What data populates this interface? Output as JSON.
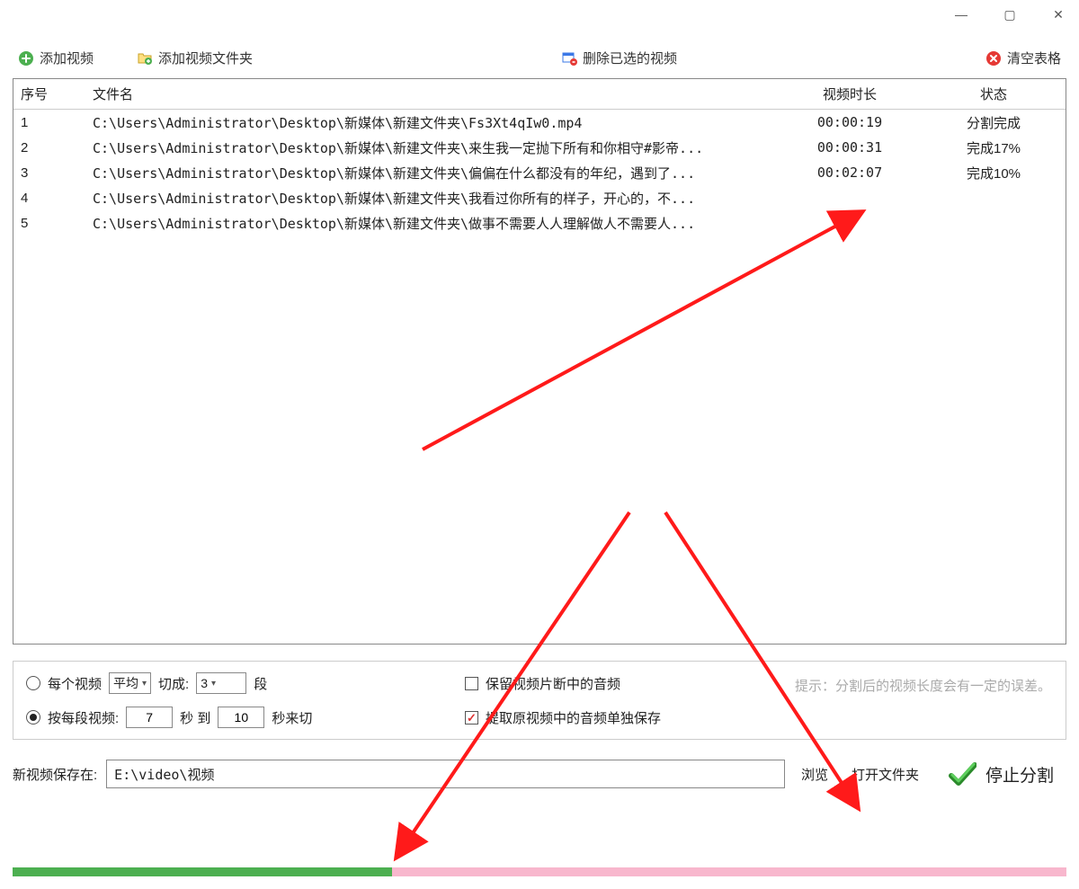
{
  "window": {
    "minimize": "—",
    "maximize": "▢",
    "close": "✕"
  },
  "toolbar": {
    "add_video": "添加视频",
    "add_folder": "添加视频文件夹",
    "delete_selected": "删除已选的视频",
    "clear_table": "清空表格"
  },
  "columns": {
    "idx": "序号",
    "name": "文件名",
    "dur": "视频时长",
    "stat": "状态"
  },
  "rows": [
    {
      "idx": "1",
      "name": "C:\\Users\\Administrator\\Desktop\\新媒体\\新建文件夹\\Fs3Xt4qIw0.mp4",
      "dur": "00:00:19",
      "stat": "分割完成"
    },
    {
      "idx": "2",
      "name": "C:\\Users\\Administrator\\Desktop\\新媒体\\新建文件夹\\来生我一定抛下所有和你相守#影帝...",
      "dur": "00:00:31",
      "stat": "完成17%"
    },
    {
      "idx": "3",
      "name": "C:\\Users\\Administrator\\Desktop\\新媒体\\新建文件夹\\偏偏在什么都没有的年纪，遇到了...",
      "dur": "00:02:07",
      "stat": "完成10%"
    },
    {
      "idx": "4",
      "name": "C:\\Users\\Administrator\\Desktop\\新媒体\\新建文件夹\\我看过你所有的样子，开心的，不...",
      "dur": "",
      "stat": ""
    },
    {
      "idx": "5",
      "name": "C:\\Users\\Administrator\\Desktop\\新媒体\\新建文件夹\\做事不需要人人理解做人不需要人...",
      "dur": "",
      "stat": ""
    }
  ],
  "options": {
    "mode1_label_a": "每个视频",
    "mode1_avg": "平均",
    "mode1_cut_as": "切成:",
    "mode1_count": "3",
    "mode1_unit": "段",
    "mode2_label": "按每段视频:",
    "mode2_from": "7",
    "mode2_sec_to": "秒 到",
    "mode2_to": "10",
    "mode2_unit": "秒来切",
    "keep_audio": "保留视频片断中的音频",
    "extract_audio": "提取原视频中的音频单独保存",
    "hint_prefix": "提示：",
    "hint_text": "分割后的视频长度会有一定的误差。"
  },
  "bottom": {
    "save_label": "新视频保存在:",
    "save_path": "E:\\video\\视频",
    "browse": "浏览",
    "open_folder": "打开文件夹",
    "action": "停止分割"
  },
  "progress_pct": 36
}
